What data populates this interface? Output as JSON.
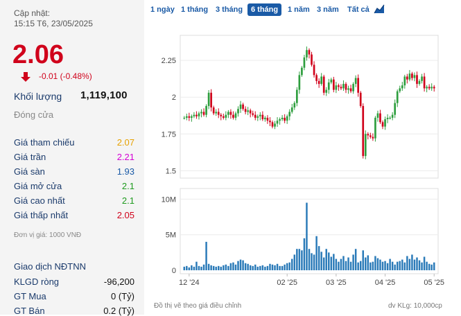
{
  "summary": {
    "updated_label": "Cập nhật:",
    "updated_time": "15:15 T6, 23/05/2025",
    "price": "2.06",
    "change": "-0.01 (-0.48%)",
    "volume_label": "Khối lượng",
    "volume_value": "1,119,100",
    "close_label": "Đóng cửa"
  },
  "stats": [
    {
      "label": "Giá tham chiếu",
      "value": "2.07",
      "color": "#e6a100"
    },
    {
      "label": "Giá trần",
      "value": "2.21",
      "color": "#d400d4"
    },
    {
      "label": "Giá sàn",
      "value": "1.93",
      "color": "#1a5aa6"
    },
    {
      "label": "Giá mở cửa",
      "value": "2.1",
      "color": "#1e9a1e"
    },
    {
      "label": "Giá cao nhất",
      "value": "2.1",
      "color": "#1e9a1e"
    },
    {
      "label": "Giá thấp nhất",
      "value": "2.05",
      "color": "#d0021b"
    }
  ],
  "unit_note": "Đơn vị giá: 1000 VNĐ",
  "foreign": {
    "title": "Giao dịch NĐTNN",
    "rows": [
      {
        "label": "KLGD ròng",
        "value": "-96,200"
      },
      {
        "label": "GT Mua",
        "value": "0 (Tỷ)"
      },
      {
        "label": "GT Bán",
        "value": "0.2 (Tỷ)"
      }
    ]
  },
  "tabs": [
    "1 ngày",
    "1 tháng",
    "3 tháng",
    "6 tháng",
    "1 năm",
    "3 năm",
    "Tất cả"
  ],
  "active_tab": "6 tháng",
  "chart_icon": "line-chart-icon",
  "footnote": "Đồ thị vẽ theo giá điều chỉnh",
  "volume_unit": "dv KLg: 10,000cp",
  "colors": {
    "up": "#2e9e3e",
    "down": "#d0021b",
    "volume": "#2a7ab8"
  },
  "chart_data": {
    "type": "candlestick",
    "x_tick_labels": [
      "12 '24",
      "02 '25",
      "03 '25",
      "04 '25",
      "05 '25"
    ],
    "y_ticks": [
      1.5,
      1.75,
      2,
      2.25
    ],
    "y_tick_labels": [
      "1.5",
      "1.75",
      "2",
      "2.25"
    ],
    "ylim": [
      1.45,
      2.42
    ],
    "volume_ticks": [
      "0",
      "5M",
      "10M"
    ],
    "volume_tick_values": [
      0,
      5,
      10
    ],
    "volume_ylim": [
      0,
      11.5
    ],
    "volume_unit": "M",
    "x_tick_index": [
      2,
      42,
      62,
      82,
      102
    ],
    "closes": [
      1.86,
      1.87,
      1.86,
      1.87,
      1.88,
      1.87,
      1.89,
      1.9,
      1.88,
      1.94,
      2.03,
      1.93,
      1.89,
      1.9,
      1.88,
      1.87,
      1.86,
      1.88,
      1.9,
      1.88,
      1.86,
      1.89,
      1.92,
      1.95,
      1.92,
      1.9,
      1.91,
      1.89,
      1.88,
      1.86,
      1.87,
      1.88,
      1.85,
      1.86,
      1.84,
      1.83,
      1.8,
      1.82,
      1.84,
      1.85,
      1.86,
      1.84,
      1.87,
      1.9,
      1.93,
      1.96,
      2.05,
      2.15,
      2.2,
      2.27,
      2.32,
      2.29,
      2.22,
      2.15,
      2.11,
      2.09,
      2.14,
      2.03,
      2.05,
      2.1,
      2.12,
      2.05,
      2.08,
      2.07,
      2.06,
      2.09,
      2.05,
      2.06,
      2.04,
      2.09,
      2.13,
      2.03,
      1.94,
      1.6,
      1.75,
      1.74,
      1.73,
      1.72,
      1.86,
      1.89,
      1.83,
      1.8,
      1.85,
      1.86,
      1.86,
      1.88,
      1.96,
      2.04,
      2.06,
      2.08,
      2.14,
      2.12,
      2.16,
      2.13,
      2.15,
      2.09,
      2.11,
      2.14,
      2.06,
      2.07,
      2.06,
      2.07,
      2.06
    ],
    "volumes": [
      0.5,
      0.6,
      0.4,
      0.7,
      0.5,
      1.2,
      0.6,
      0.5,
      0.8,
      4.0,
      0.9,
      0.7,
      0.6,
      0.5,
      0.6,
      0.5,
      0.7,
      0.8,
      0.6,
      1.0,
      1.1,
      0.8,
      1.3,
      1.5,
      1.4,
      1.0,
      0.9,
      0.7,
      0.6,
      0.8,
      0.5,
      0.6,
      0.7,
      0.5,
      0.6,
      0.9,
      0.8,
      0.7,
      0.9,
      0.6,
      0.6,
      0.8,
      1.0,
      1.1,
      1.6,
      2.2,
      3.0,
      3.0,
      2.8,
      4.5,
      9.5,
      3.0,
      2.4,
      2.2,
      4.8,
      3.4,
      2.6,
      1.8,
      3.0,
      2.5,
      1.9,
      2.3,
      1.6,
      1.2,
      1.6,
      2.0,
      1.3,
      1.8,
      1.2,
      2.2,
      3.0,
      1.1,
      1.3,
      2.8,
      1.8,
      2.1,
      1.1,
      1.2,
      2.0,
      1.7,
      1.5,
      1.2,
      1.3,
      1.0,
      1.6,
      1.2,
      0.8,
      1.2,
      1.3,
      1.5,
      1.1,
      2.0,
      1.6,
      2.2,
      1.5,
      1.8,
      1.4,
      1.1,
      1.9,
      1.2,
      0.9,
      0.8,
      1.1
    ]
  }
}
